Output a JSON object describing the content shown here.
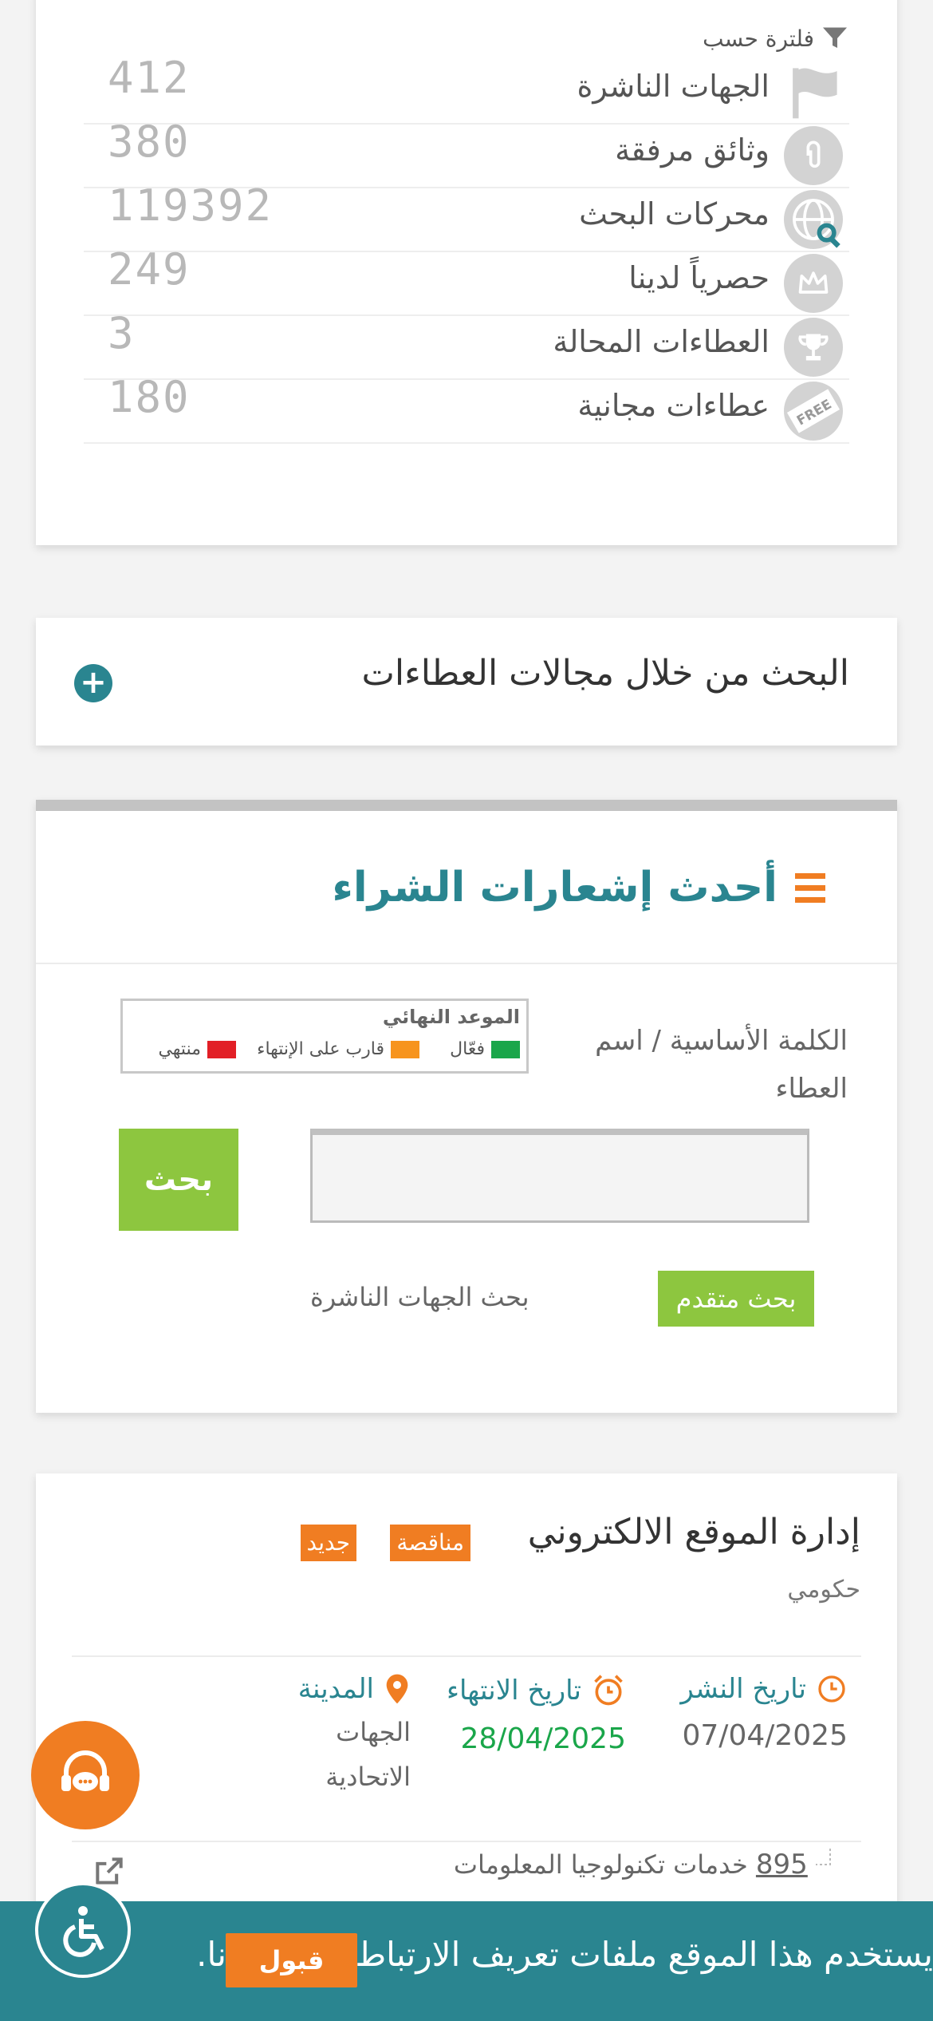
{
  "filter": {
    "heading": "فلترة حسب",
    "rows": [
      {
        "label": "الجهات الناشرة",
        "count": "412",
        "icon": "flag-icon"
      },
      {
        "label": "وثائق مرفقة",
        "count": "380",
        "icon": "paperclip-icon"
      },
      {
        "label": "محركات البحث",
        "count": "119392",
        "icon": "globe-search-icon"
      },
      {
        "label": "حصرياً لدينا",
        "count": "249",
        "icon": "crown-icon"
      },
      {
        "label": "العطاءات المحالة",
        "count": "3",
        "icon": "trophy-icon"
      },
      {
        "label": "عطاءات مجانية",
        "count": "180",
        "icon": "free-tag-icon"
      }
    ]
  },
  "sectors": {
    "title": "البحث من خلال مجالات العطاءات",
    "toggle": "+"
  },
  "purchase": {
    "title": "أحدث إشعارات الشراء",
    "keyword_label": "الكلمة الأساسية / اسم العطاء",
    "search_value": "",
    "search_button": "بحث",
    "advanced_button": "بحث متقدم",
    "publishers_link": "بحث الجهات الناشرة",
    "legend": {
      "title": "الموعد النهائي",
      "items": [
        {
          "label": "فعّال",
          "color": "#1aa64a"
        },
        {
          "label": "قارب على الإنتهاء",
          "color": "#f7941d"
        },
        {
          "label": "منتهي",
          "color": "#e21f26"
        }
      ]
    }
  },
  "tender": {
    "title": "إدارة الموقع الالكتروني",
    "badge_type": "مناقصة",
    "badge_new": "جديد",
    "sector": "حكومي",
    "publish_label": "تاريخ النشر",
    "publish_date": "07/04/2025",
    "end_label": "تاريخ الانتهاء",
    "end_date": "28/04/2025",
    "city_label": "المدينة",
    "city_value": "الجهات الاتحادية",
    "category_number": "895",
    "category_name": "خدمات تكنولوجيا المعلومات"
  },
  "cookie": {
    "text": "يستخدم هذا الموقع ملفات تعريف الارتباط لتحسين تجربتك. باستخدامك لموقعنا،",
    "visible_text": "يستخدم هذا الموقع ملفات تعريف الارتباط ستخدام نا.",
    "accept": "قبول"
  },
  "colors": {
    "accent_teal": "#2a8590",
    "accent_orange": "#f07d22",
    "accent_green": "#8dc63f",
    "date_green": "#1aa64a"
  }
}
